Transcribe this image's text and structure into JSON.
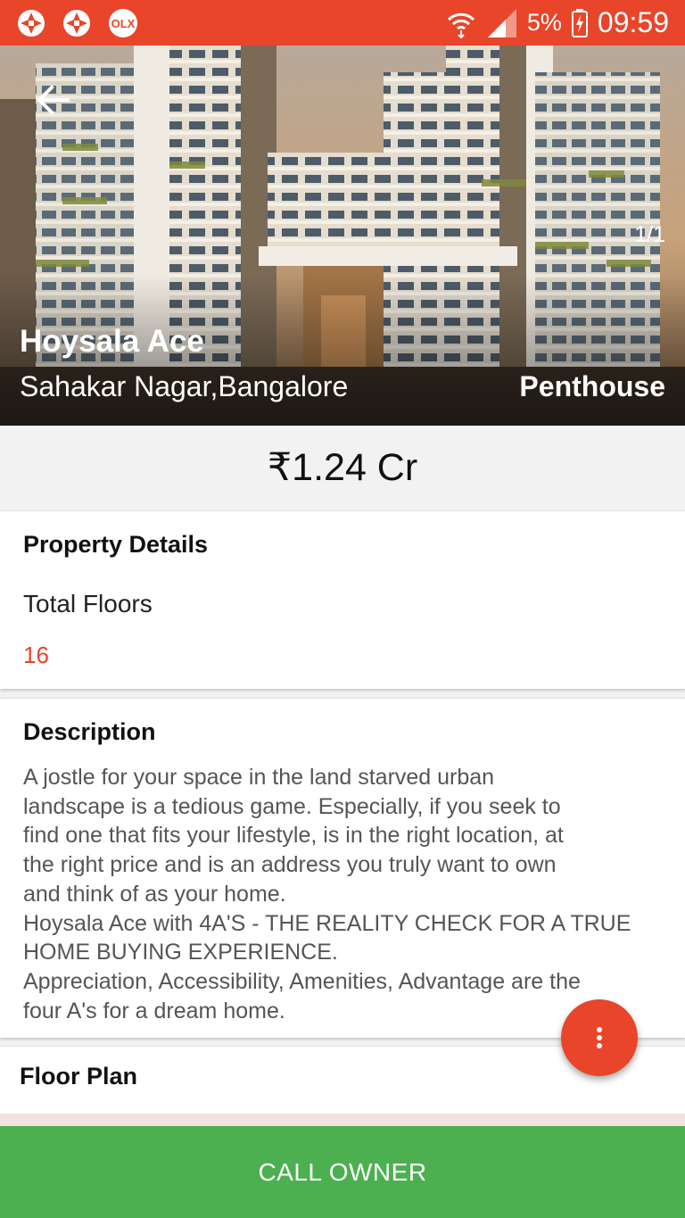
{
  "status_bar": {
    "left_icons": [
      "aperture-icon",
      "aperture-icon",
      "olx-icon"
    ],
    "olx_text": "OLX",
    "battery": "5%",
    "time": "09:59",
    "color": "#e8452a"
  },
  "hero": {
    "counter": "1/1",
    "title": "Hoysala Ace",
    "location": "Sahakar Nagar,Bangalore",
    "property_type": "Penthouse"
  },
  "price": "₹1.24 Cr",
  "property_details": {
    "heading": "Property Details",
    "label": "Total Floors",
    "value": "16",
    "value_color": "#e8452a"
  },
  "description": {
    "heading": "Description",
    "lines": [
      "A jostle for your space in the land starved urban",
      "landscape is a tedious game. Especially, if you seek to",
      "find one that fits your lifestyle, is in the right location, at",
      "the right price and is an address you truly want to own",
      "and think of as your home.",
      "Hoysala Ace with 4A'S - THE REALITY CHECK FOR A TRUE",
      "HOME BUYING EXPERIENCE.",
      "Appreciation, Accessibility, Amenities, Advantage are the",
      "four A's for a dream home."
    ]
  },
  "floor_plan": {
    "heading": "Floor Plan"
  },
  "fab_icon": "more-vertical-icon",
  "call_button": {
    "label": "CALL OWNER",
    "color": "#4caf50"
  }
}
